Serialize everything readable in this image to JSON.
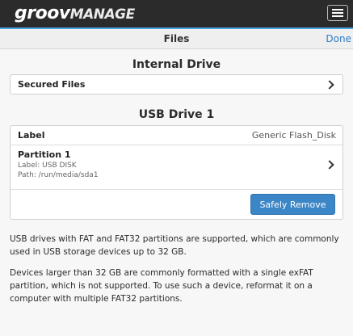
{
  "header": {
    "logo_strong": "groov",
    "logo_light": "MANAGE"
  },
  "navbar": {
    "title": "Files",
    "done_label": "Done"
  },
  "internal_drive": {
    "title": "Internal Drive",
    "secured_files_label": "Secured Files"
  },
  "usb_drive": {
    "title": "USB Drive 1",
    "label_key": "Label",
    "label_value": "Generic Flash_Disk",
    "partition": {
      "name": "Partition 1",
      "label_line": "Label: USB DISK",
      "path_line": "Path: /run/media/sda1"
    },
    "remove_button": "Safely Remove"
  },
  "info": {
    "para1": "USB drives with FAT and FAT32 partitions are supported, which are commonly used in USB storage devices up to 32 GB.",
    "para2": "Devices larger than 32 GB are commonly formatted with a single exFAT partition, which is not supported. To use such a device, reformat it on a computer with multiple FAT32 partitions."
  }
}
